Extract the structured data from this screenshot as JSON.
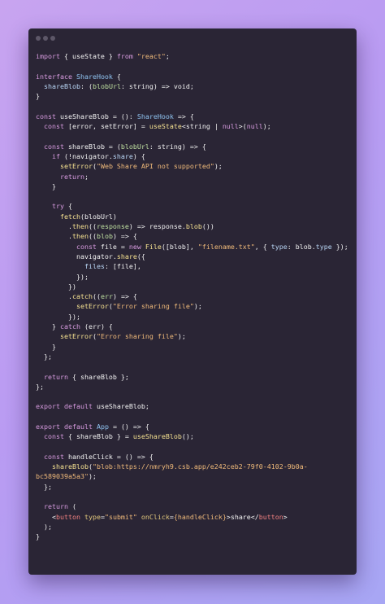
{
  "window": {
    "dots": [
      "",
      "",
      ""
    ]
  },
  "code": {
    "lines": [
      [
        [
          "kw",
          "import"
        ],
        [
          "txt",
          " { useState } "
        ],
        [
          "kw",
          "from"
        ],
        [
          "txt",
          " "
        ],
        [
          "str",
          "\"react\""
        ],
        [
          "txt",
          ";"
        ]
      ],
      [],
      [
        [
          "kw",
          "interface"
        ],
        [
          "txt",
          " "
        ],
        [
          "type",
          "ShareHook"
        ],
        [
          "txt",
          " {"
        ]
      ],
      [
        [
          "txt",
          "  "
        ],
        [
          "prop",
          "shareBlob"
        ],
        [
          "txt",
          ": ("
        ],
        [
          "var",
          "blobUrl"
        ],
        [
          "txt",
          ": string) => void;"
        ]
      ],
      [
        [
          "txt",
          "}"
        ]
      ],
      [],
      [
        [
          "kw",
          "const"
        ],
        [
          "txt",
          " useShareBlob = (): "
        ],
        [
          "type",
          "ShareHook"
        ],
        [
          "txt",
          " => {"
        ]
      ],
      [
        [
          "txt",
          "  "
        ],
        [
          "kw",
          "const"
        ],
        [
          "txt",
          " [error, setError] = "
        ],
        [
          "fn",
          "useState"
        ],
        [
          "txt",
          "<string | "
        ],
        [
          "null",
          "null"
        ],
        [
          "txt",
          ">("
        ],
        [
          "null",
          "null"
        ],
        [
          "txt",
          ");"
        ]
      ],
      [],
      [
        [
          "txt",
          "  "
        ],
        [
          "kw",
          "const"
        ],
        [
          "txt",
          " shareBlob = ("
        ],
        [
          "var",
          "blobUrl"
        ],
        [
          "txt",
          ": string) => {"
        ]
      ],
      [
        [
          "txt",
          "    "
        ],
        [
          "kw",
          "if"
        ],
        [
          "txt",
          " (!navigator."
        ],
        [
          "prop",
          "share"
        ],
        [
          "txt",
          ") {"
        ]
      ],
      [
        [
          "txt",
          "      "
        ],
        [
          "fn",
          "setError"
        ],
        [
          "txt",
          "("
        ],
        [
          "str",
          "\"Web Share API not supported\""
        ],
        [
          "txt",
          ");"
        ]
      ],
      [
        [
          "txt",
          "      "
        ],
        [
          "kw",
          "return"
        ],
        [
          "txt",
          ";"
        ]
      ],
      [
        [
          "txt",
          "    }"
        ]
      ],
      [],
      [
        [
          "txt",
          "    "
        ],
        [
          "kw",
          "try"
        ],
        [
          "txt",
          " {"
        ]
      ],
      [
        [
          "txt",
          "      "
        ],
        [
          "fn",
          "fetch"
        ],
        [
          "txt",
          "(blobUrl)"
        ]
      ],
      [
        [
          "txt",
          "        ."
        ],
        [
          "fn",
          "then"
        ],
        [
          "txt",
          "(("
        ],
        [
          "var",
          "response"
        ],
        [
          "txt",
          ") => response."
        ],
        [
          "fn",
          "blob"
        ],
        [
          "txt",
          "())"
        ]
      ],
      [
        [
          "txt",
          "        ."
        ],
        [
          "fn",
          "then"
        ],
        [
          "txt",
          "(("
        ],
        [
          "var",
          "blob"
        ],
        [
          "txt",
          ") => {"
        ]
      ],
      [
        [
          "txt",
          "          "
        ],
        [
          "kw",
          "const"
        ],
        [
          "txt",
          " file = "
        ],
        [
          "kw",
          "new"
        ],
        [
          "txt",
          " "
        ],
        [
          "fn",
          "File"
        ],
        [
          "txt",
          "([blob], "
        ],
        [
          "str",
          "\"filename.txt\""
        ],
        [
          "txt",
          ", { "
        ],
        [
          "prop",
          "type"
        ],
        [
          "txt",
          ": blob."
        ],
        [
          "prop",
          "type"
        ],
        [
          "txt",
          " });"
        ]
      ],
      [
        [
          "txt",
          "          navigator."
        ],
        [
          "fn",
          "share"
        ],
        [
          "txt",
          "({"
        ]
      ],
      [
        [
          "txt",
          "            "
        ],
        [
          "prop",
          "files"
        ],
        [
          "txt",
          ": [file],"
        ]
      ],
      [
        [
          "txt",
          "          });"
        ]
      ],
      [
        [
          "txt",
          "        })"
        ]
      ],
      [
        [
          "txt",
          "        ."
        ],
        [
          "fn",
          "catch"
        ],
        [
          "txt",
          "(("
        ],
        [
          "var",
          "err"
        ],
        [
          "txt",
          ") => {"
        ]
      ],
      [
        [
          "txt",
          "          "
        ],
        [
          "fn",
          "setError"
        ],
        [
          "txt",
          "("
        ],
        [
          "str",
          "\"Error sharing file\""
        ],
        [
          "txt",
          ");"
        ]
      ],
      [
        [
          "txt",
          "        });"
        ]
      ],
      [
        [
          "txt",
          "    } "
        ],
        [
          "kw",
          "catch"
        ],
        [
          "txt",
          " (err) {"
        ]
      ],
      [
        [
          "txt",
          "      "
        ],
        [
          "fn",
          "setError"
        ],
        [
          "txt",
          "("
        ],
        [
          "str",
          "\"Error sharing file\""
        ],
        [
          "txt",
          ");"
        ]
      ],
      [
        [
          "txt",
          "    }"
        ]
      ],
      [
        [
          "txt",
          "  };"
        ]
      ],
      [],
      [
        [
          "txt",
          "  "
        ],
        [
          "kw",
          "return"
        ],
        [
          "txt",
          " { shareBlob };"
        ]
      ],
      [
        [
          "txt",
          "};"
        ]
      ],
      [],
      [
        [
          "kw",
          "export"
        ],
        [
          "txt",
          " "
        ],
        [
          "kw",
          "default"
        ],
        [
          "txt",
          " useShareBlob;"
        ]
      ],
      [],
      [
        [
          "kw",
          "export"
        ],
        [
          "txt",
          " "
        ],
        [
          "kw",
          "default"
        ],
        [
          "txt",
          " "
        ],
        [
          "type",
          "App"
        ],
        [
          "txt",
          " = () => {"
        ]
      ],
      [
        [
          "txt",
          "  "
        ],
        [
          "kw",
          "const"
        ],
        [
          "txt",
          " { shareBlob } = "
        ],
        [
          "fn",
          "useShareBlob"
        ],
        [
          "txt",
          "();"
        ]
      ],
      [],
      [
        [
          "txt",
          "  "
        ],
        [
          "kw",
          "const"
        ],
        [
          "txt",
          " handleClick = () => {"
        ]
      ],
      [
        [
          "txt",
          "    "
        ],
        [
          "fn",
          "shareBlob"
        ],
        [
          "txt",
          "("
        ],
        [
          "str",
          "\"blob:https://nmryh9.csb.app/e242ceb2-79f0-4102-9b0a-"
        ]
      ],
      [
        [
          "str",
          "bc589039a5a3\""
        ],
        [
          "txt",
          ");"
        ]
      ],
      [
        [
          "txt",
          "  };"
        ]
      ],
      [],
      [
        [
          "txt",
          "  "
        ],
        [
          "kw",
          "return"
        ],
        [
          "txt",
          " ("
        ]
      ],
      [
        [
          "txt",
          "    <"
        ],
        [
          "tag",
          "button"
        ],
        [
          "txt",
          " "
        ],
        [
          "attr",
          "type"
        ],
        [
          "txt",
          "="
        ],
        [
          "str",
          "\"submit\""
        ],
        [
          "txt",
          " "
        ],
        [
          "attr",
          "onClick"
        ],
        [
          "txt",
          "="
        ],
        [
          "str",
          "{handleClick}"
        ],
        [
          "txt",
          ">share</"
        ],
        [
          "tag",
          "button"
        ],
        [
          "txt",
          ">"
        ]
      ],
      [
        [
          "txt",
          "  );"
        ]
      ],
      [
        [
          "txt",
          "}"
        ]
      ]
    ]
  }
}
